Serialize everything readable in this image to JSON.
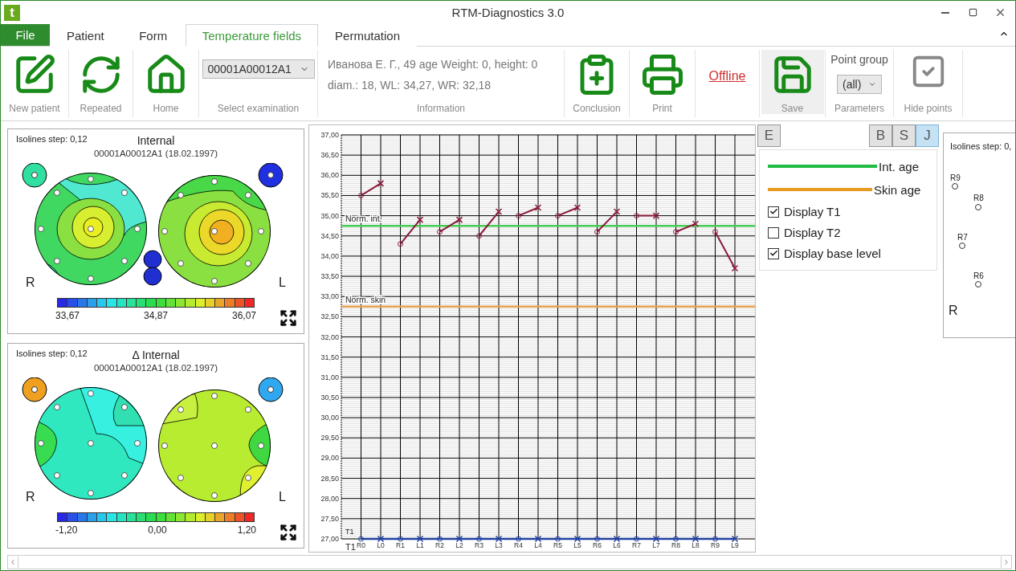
{
  "window": {
    "logo": "t",
    "title": "RTM-Diagnostics 3.0"
  },
  "ribbon_tabs": [
    {
      "label": "File",
      "kind": "menu",
      "selected": false
    },
    {
      "label": "Patient",
      "kind": "tab",
      "selected": false
    },
    {
      "label": "Form",
      "kind": "tab",
      "selected": false
    },
    {
      "label": "Temperature fields",
      "kind": "tab",
      "selected": true
    },
    {
      "label": "Permutation",
      "kind": "tab",
      "selected": false
    }
  ],
  "ribbon_groups": [
    {
      "kind": "edit",
      "label": "New patient"
    },
    {
      "kind": "refresh",
      "label": "Repeated"
    },
    {
      "kind": "home",
      "label": "Home"
    },
    {
      "kind": "select",
      "value": "00001A00012A1",
      "label": "Select examination"
    },
    {
      "kind": "info",
      "lines": [
        "Иванова Е. Г., 49 age Weight: 0, height: 0",
        "diam.: 18, WL: 34,27, WR: 32,18"
      ],
      "label": "Information"
    },
    {
      "kind": "clipboard",
      "label": "Conclusion"
    },
    {
      "kind": "print",
      "label": "Print"
    },
    {
      "kind": "link",
      "text": "Offline"
    },
    {
      "kind": "save",
      "label": "Save"
    },
    {
      "kind": "parameters",
      "heading": "Point group",
      "value": "(all)",
      "label": "Parameters"
    },
    {
      "kind": "check",
      "label": "Hide points"
    }
  ],
  "maps": [
    {
      "kind": "absolute",
      "isolines": "Isolines step: 0,12",
      "title": "Internal",
      "subtitle": "00001A00012A1 (18.02.1997)",
      "left_label": "R",
      "right_label": "L",
      "scale": [
        "33,67",
        "34,87",
        "36,07"
      ]
    },
    {
      "kind": "delta",
      "isolines": "Isolines step: 0,12",
      "title": "Δ Internal",
      "subtitle": "00001A00012A1 (18.02.1997)",
      "left_label": "R",
      "right_label": "L",
      "scale": [
        "-1,20",
        "0,00",
        "1,20"
      ]
    }
  ],
  "chart": {
    "chart_data": {
      "type": "line",
      "categories": [
        "R0",
        "L0",
        "R1",
        "L1",
        "R2",
        "L2",
        "R3",
        "L3",
        "R4",
        "L4",
        "R5",
        "L5",
        "R6",
        "L6",
        "R7",
        "L7",
        "R8",
        "L8",
        "R9",
        "L9"
      ],
      "ylim": [
        27,
        37
      ],
      "xlabel": "T1",
      "yticks": [
        {
          "value": 27,
          "label": "27,00"
        },
        {
          "value": 27.5,
          "label": "27,50"
        },
        {
          "value": 28,
          "label": "28,00"
        },
        {
          "value": 28.5,
          "label": "28,50"
        },
        {
          "value": 29,
          "label": "29,00"
        },
        {
          "value": 29.5,
          "label": "29,50"
        },
        {
          "value": 30,
          "label": "30,00"
        },
        {
          "value": 30.5,
          "label": "30,50"
        },
        {
          "value": 31,
          "label": "31,00"
        },
        {
          "value": 31.5,
          "label": "31,50"
        },
        {
          "value": 32,
          "label": "32,00"
        },
        {
          "value": 32.5,
          "label": "32,50"
        },
        {
          "value": 33,
          "label": "33,00"
        },
        {
          "value": 33.5,
          "label": "33,50"
        },
        {
          "value": 34,
          "label": "34,00"
        },
        {
          "value": 34.5,
          "label": "34,50"
        },
        {
          "value": 35,
          "label": "35,00"
        },
        {
          "value": 35.5,
          "label": "35,50"
        },
        {
          "value": 36,
          "label": "36,00"
        },
        {
          "value": 36.5,
          "label": "36,50"
        },
        {
          "value": 37,
          "label": "37,00"
        }
      ],
      "grid": true,
      "series": [
        {
          "color": "#8b1a3a",
          "marker": "circle",
          "values": [
            35.5,
            35.8,
            34.3,
            34.9,
            34.6,
            34.9,
            34.5,
            35.1,
            35.0,
            35.2,
            35.0,
            35.2,
            34.6,
            35.1,
            35.0,
            35.0,
            34.6,
            34.8,
            34.6,
            33.7
          ]
        },
        {
          "name": "T1",
          "color": "#2040a0",
          "marker": "circle",
          "values": [
            27,
            27,
            27,
            27,
            27,
            27,
            27,
            27,
            27,
            27,
            27,
            27,
            27,
            27,
            27,
            27,
            27,
            27,
            27,
            27
          ]
        }
      ],
      "ref_lines": [
        {
          "axis": "y",
          "value": 34.75,
          "label": "Norm. int.",
          "color": "#44cc55"
        },
        {
          "axis": "y",
          "value": 32.75,
          "label": "Norm. skin",
          "color": "#e8a050"
        }
      ]
    }
  },
  "side_panel": {
    "tabs": [
      {
        "label": "E",
        "selected": false
      },
      {
        "label": "B",
        "selected": false
      },
      {
        "label": "S",
        "selected": false
      },
      {
        "label": "J",
        "selected": true
      }
    ],
    "legend": [
      {
        "label": "Int. age",
        "color": "#22bb44"
      },
      {
        "label": "Skin age",
        "color": "#e89a20"
      }
    ],
    "options": [
      {
        "label": "Display T1",
        "checked": true
      },
      {
        "label": "Display T2",
        "checked": false
      },
      {
        "label": "Display base level",
        "checked": true
      }
    ]
  },
  "partial_map": {
    "isolines": "Isolines step: 0,",
    "points": [
      "R9",
      "R8",
      "R7",
      "R6"
    ],
    "side_label": "R"
  }
}
